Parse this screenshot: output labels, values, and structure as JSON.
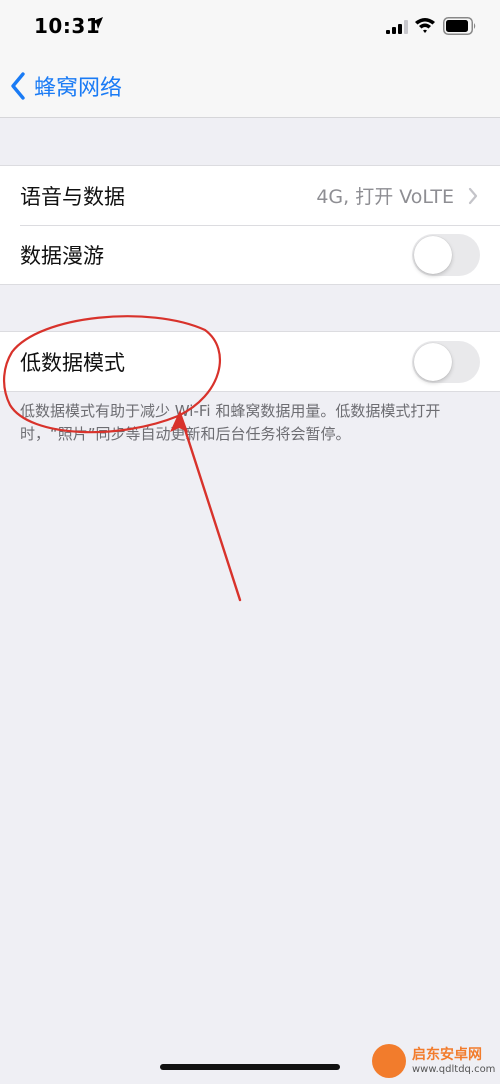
{
  "status_bar": {
    "time": "10:31",
    "icons": [
      "location-arrow-icon",
      "cellular-signal-icon",
      "wifi-icon",
      "battery-icon"
    ]
  },
  "nav": {
    "back_label": "蜂窝网络",
    "back_icon": "chevron-left-icon",
    "accent_color": "#1a7bf5"
  },
  "groups": [
    {
      "rows": [
        {
          "label": "语音与数据",
          "value": "4G, 打开 VoLTE",
          "accessory": "chevron-right-icon"
        },
        {
          "label": "数据漫游",
          "toggle": false
        }
      ]
    },
    {
      "rows": [
        {
          "label": "低数据模式",
          "toggle": false
        }
      ],
      "footer": "低数据模式有助于减少 Wi-Fi 和蜂窝数据用量。低数据模式打开时，“照片”同步等自动更新和后台任务将会暂停。"
    }
  ],
  "annotation": {
    "color": "#d8322b",
    "shapes": [
      "ellipse",
      "arrow"
    ]
  },
  "watermark": {
    "title": "启东安卓网",
    "url": "www.qdltdq.com"
  }
}
